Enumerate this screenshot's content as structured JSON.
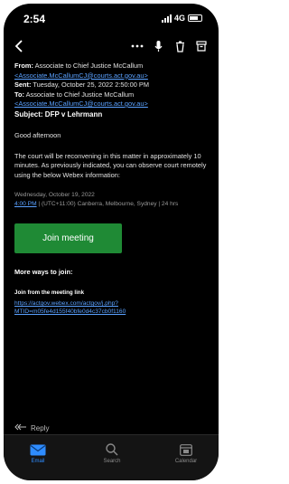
{
  "status": {
    "time": "2:54",
    "network": "4G"
  },
  "email": {
    "from_label": "From:",
    "from_name": "Associate to Chief Justice McCallum",
    "from_email": "<Associate.McCallumCJ@courts.act.gov.au>",
    "sent_label": "Sent:",
    "sent_value": "Tuesday, October 25, 2022 2:50:00 PM",
    "to_label": "To:",
    "to_name": "Associate to Chief Justice McCallum",
    "to_email": "<Associate.McCallumCJ@courts.act.gov.au>",
    "subject_label": "Subject:",
    "subject": "DFP v Lehrmann",
    "greeting": "Good afternoon",
    "body": "The court will be reconvening in this matter in approximately 10 minutes. As previously indicated, you can observe court remotely using the below Webex information:",
    "meeting_date": "Wednesday, October 19, 2022",
    "meeting_time": "4:00 PM",
    "meeting_tz": "| (UTC+11:00) Canberra, Melbourne, Sydney | 24 hrs",
    "join_button": "Join meeting",
    "more_ways": "More ways to join:",
    "join_link_label": "Join from the meeting link",
    "link_line1": "https://actgov.webex.com/actgov/j.php?",
    "link_line2": "MTID=m05fe4d155f40bfe0d4c37cb0f1160"
  },
  "reply_label": "Reply",
  "tabs": [
    {
      "label": "Email"
    },
    {
      "label": "Search"
    },
    {
      "label": "Calendar"
    }
  ],
  "colors": {
    "accent": "#2e8cff",
    "join": "#1f8a35",
    "link": "#5aa1ff"
  }
}
